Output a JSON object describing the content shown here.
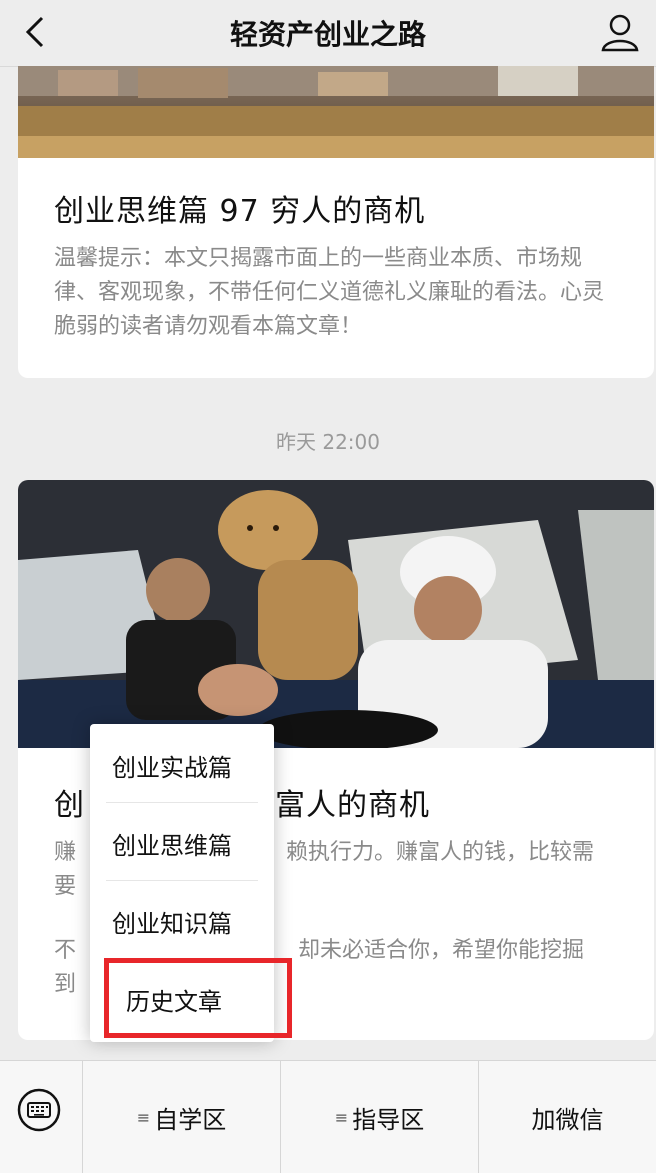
{
  "header": {
    "title": "轻资产创业之路"
  },
  "articles": [
    {
      "title": "创业思维篇 97 穷人的商机",
      "desc": "温馨提示：本文只揭露市面上的一些商业本质、市场规律、客观现象，不带任何仁义道德礼义廉耻的看法。心灵脆弱的读者请勿观看本篇文章！"
    },
    {
      "title": "创",
      "title_tail": "富人的商机",
      "desc_a_head": "赚",
      "desc_a_tail": "赖执行力。赚富人的钱，比较需",
      "desc_a_line2": "要",
      "desc_b_head": "不",
      "desc_b_tail": "却未必适合你，希望你能挖掘",
      "desc_b_line2": "到"
    }
  ],
  "timestamp": "昨天 22:00",
  "popup_menu": {
    "items": [
      "创业实战篇",
      "创业思维篇",
      "创业知识篇",
      "历史文章"
    ],
    "highlight_color": "#e8262a"
  },
  "bottom_menu": {
    "items": [
      "自学区",
      "指导区",
      "加微信"
    ]
  }
}
